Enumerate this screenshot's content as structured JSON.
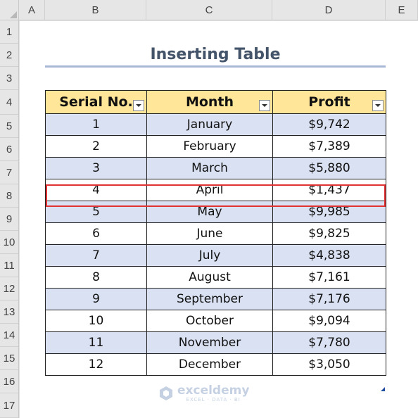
{
  "columns": [
    "A",
    "B",
    "C",
    "D",
    "E"
  ],
  "rows": [
    "1",
    "2",
    "3",
    "4",
    "5",
    "6",
    "7",
    "8",
    "9",
    "10",
    "11",
    "12",
    "13",
    "14",
    "15",
    "16",
    "17"
  ],
  "title": "Inserting Table",
  "table": {
    "headers": [
      "Serial No.",
      "Month",
      "Profit"
    ],
    "rows": [
      [
        "1",
        "January",
        "$9,742"
      ],
      [
        "2",
        "February",
        "$7,389"
      ],
      [
        "3",
        "March",
        "$5,880"
      ],
      [
        "4",
        "April",
        "$1,437"
      ],
      [
        "5",
        "May",
        "$9,985"
      ],
      [
        "6",
        "June",
        "$9,825"
      ],
      [
        "7",
        "July",
        "$4,838"
      ],
      [
        "8",
        "August",
        "$7,161"
      ],
      [
        "9",
        "September",
        "$7,176"
      ],
      [
        "10",
        "October",
        "$9,094"
      ],
      [
        "11",
        "November",
        "$7,780"
      ],
      [
        "12",
        "December",
        "$3,050"
      ]
    ]
  },
  "watermark": {
    "name": "exceldemy",
    "tagline": "EXCEL · DATA · BI"
  },
  "colors": {
    "header_fill": "#ffe699",
    "band_fill": "#d9e1f2",
    "highlight": "#e03232",
    "title": "#44546a"
  }
}
